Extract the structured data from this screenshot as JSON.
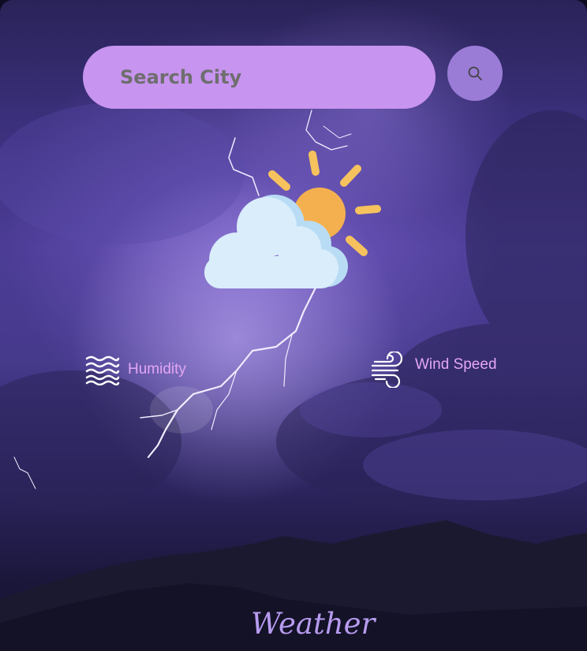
{
  "app": {
    "brand": "Weather"
  },
  "search": {
    "placeholder": "Search City",
    "value": "",
    "button_icon": "search-icon"
  },
  "current": {
    "condition_icon": "partly-cloudy-icon"
  },
  "stats": {
    "humidity": {
      "label": "Humidity",
      "icon": "waves-icon"
    },
    "wind": {
      "label": "Wind Speed",
      "icon": "wind-icon"
    }
  },
  "colors": {
    "search_bar": "#c794ef",
    "search_button": "#9a7cd7",
    "label": "#e3a6f5",
    "brand": "#b79cf0",
    "sun": "#f4b04f",
    "cloud": "#d8ecfb"
  }
}
